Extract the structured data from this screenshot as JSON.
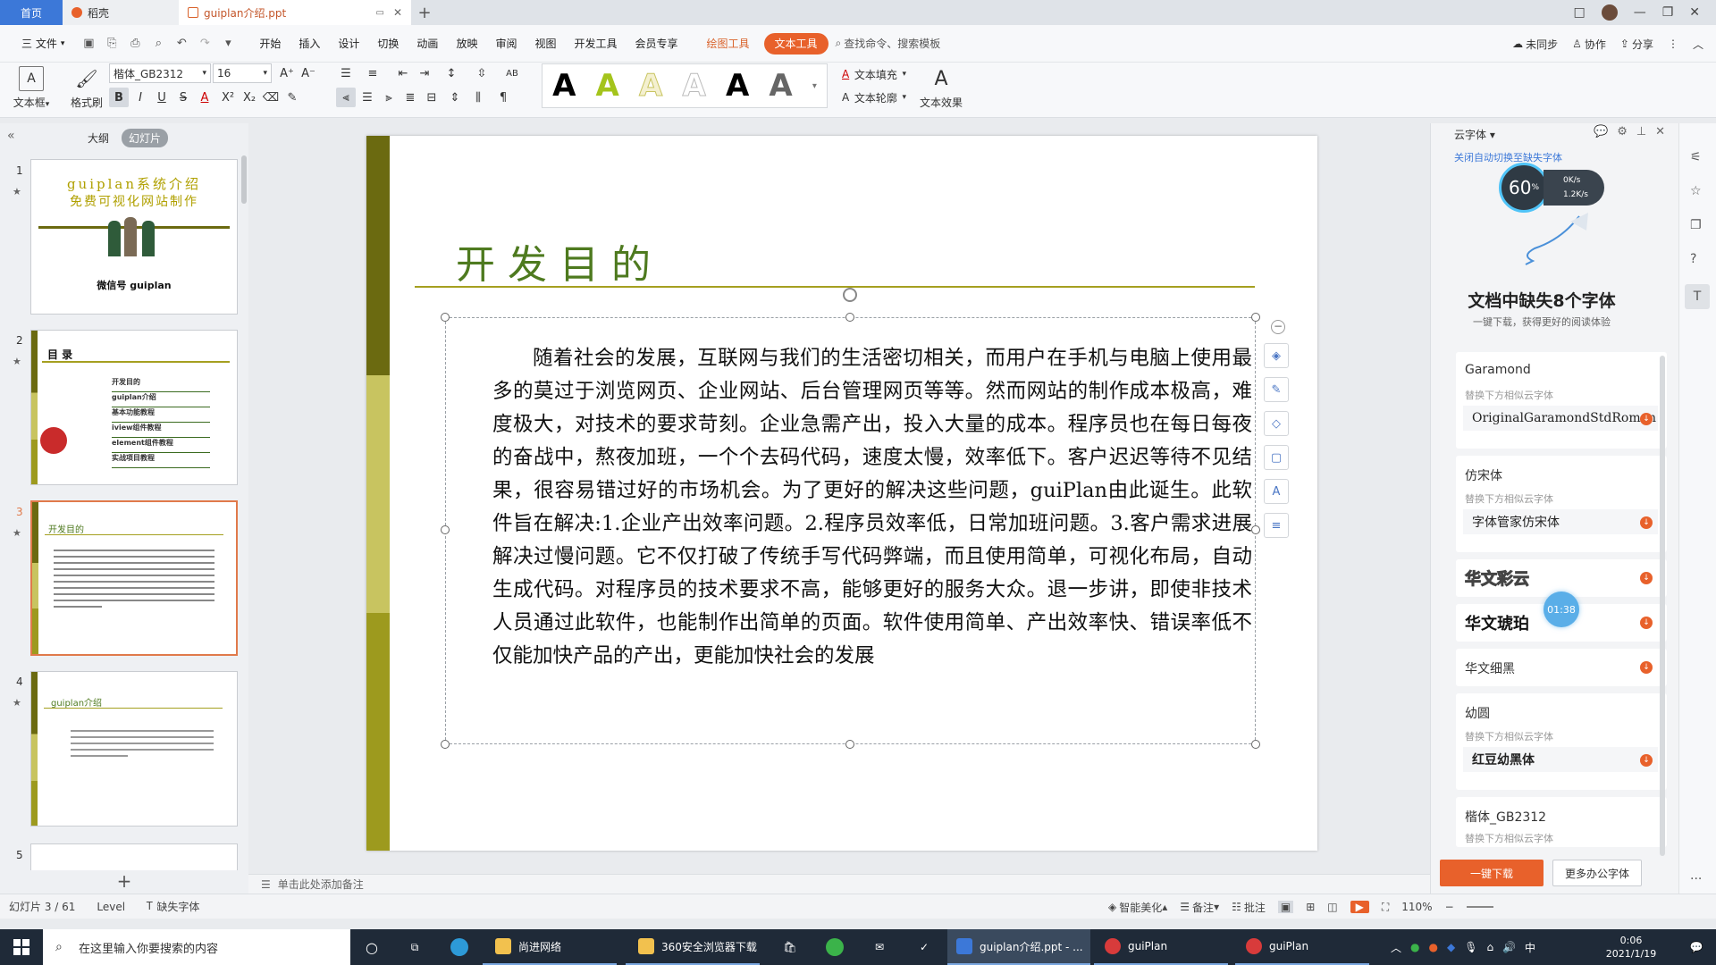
{
  "titlebar": {
    "tabs": [
      "首页",
      "稻壳",
      "guiplan介绍.ppt"
    ],
    "plus": "+",
    "win_controls": [
      "□",
      "—",
      "❐",
      "✕"
    ]
  },
  "menubar": {
    "file": "三 文件",
    "items": [
      "开始",
      "插入",
      "设计",
      "切换",
      "动画",
      "放映",
      "审阅",
      "视图",
      "开发工具",
      "会员专享"
    ],
    "drawing_tools": "绘图工具",
    "text_tools": "文本工具",
    "search": "查找命令、搜索模板",
    "right": [
      "未同步",
      "协作",
      "分享"
    ]
  },
  "ribbon": {
    "textbox_label": "文本框",
    "format_painter_label": "格式刷",
    "font_name": "楷体_GB2312",
    "font_size": "16",
    "gallery_glyph": "A",
    "text_fill": "文本填充",
    "text_outline": "文本轮廓",
    "text_effect": "文本效果"
  },
  "leftpanel": {
    "tab_outline": "大纲",
    "tab_slides": "幻灯片",
    "slide_nums": [
      "1",
      "2",
      "3",
      "4",
      "5"
    ],
    "thumb1_title": "guiplan系统介绍",
    "thumb1_sub": "免费可视化网站制作",
    "thumb1_wechat": "微信号   guiplan",
    "thumb2_title": "目 录",
    "thumb2_items": [
      "开发目的",
      "guiplan介绍",
      "基本功能教程",
      "iview组件教程",
      "element组件教程",
      "实战项目教程"
    ],
    "thumb3_title": "开发目的",
    "thumb4_title": "guiplan介绍",
    "add_slide": "+"
  },
  "slide": {
    "title": "开发目的",
    "body": "随着社会的发展，互联网与我们的生活密切相关，而用户在手机与电脑上使用最多的莫过于浏览网页、企业网站、后台管理网页等等。然而网站的制作成本极高，难度极大，对技术的要求苛刻。企业急需产出，投入大量的成本。程序员也在每日每夜的奋战中，熬夜加班，一个个去码代码，速度太慢，效率低下。客户迟迟等待不见结果，很容易错过好的市场机会。为了更好的解决这些问题，guiPlan由此诞生。此软件旨在解决:1.企业产出效率问题。2.程序员效率低，日常加班问题。3.客户需求进展解决过慢问题。它不仅打破了传统手写代码弊端，而且使用简单，可视化布局，自动生成代码。对程序员的技术要求不高，能够更好的服务大众。退一步讲，即使非技术人员通过此软件，也能制作出简单的页面。软件使用简单、产出效率快、错误率低不仅能加快产品的产出，更能加快社会的发展"
  },
  "notes": {
    "placeholder": "单击此处添加备注"
  },
  "rightpanel": {
    "header": "云字体",
    "notice": "关闭自动切换至缺失字体",
    "speed_percent": "60",
    "speed_unit": "%",
    "speed_up": "0K/s",
    "speed_down": "1.2K/s",
    "missing_title": "文档中缺失8个字体",
    "missing_sub": "一键下载，获得更好的阅读体验",
    "replace_hint": "替换下方相似云字体",
    "fonts": [
      {
        "name": "Garamond",
        "similar": "OriginalGaramondStdRoman"
      },
      {
        "name": "仿宋体",
        "similar": "字体管家仿宋体"
      },
      {
        "name": "华文彩云",
        "similar": ""
      },
      {
        "name": "华文琥珀",
        "similar": ""
      },
      {
        "name": "华文细黑",
        "similar": ""
      },
      {
        "name": "幼圆",
        "similar": "红豆幼黑体"
      },
      {
        "name": "楷体_GB2312",
        "similar": ""
      }
    ],
    "timer": "01:38",
    "download_all": "一键下载",
    "more_fonts": "更多办公字体"
  },
  "statusbar": {
    "slide_info": "幻灯片 3 / 61",
    "level": "Level",
    "missing_fonts": "缺失字体",
    "smart_beautify": "智能美化",
    "notes": "备注",
    "comments": "批注",
    "zoom": "110%"
  },
  "taskbar": {
    "search_placeholder": "在这里输入你要搜索的内容",
    "items": [
      "尚进网络",
      "360安全浏览器下载",
      "guiplan介绍.ppt - ...",
      "guiPlan",
      "guiPlan"
    ],
    "ime": "中",
    "time": "0:06",
    "date": "2021/1/19"
  },
  "colors": {
    "accent": "#e8612b",
    "title_green": "#4e7a1f",
    "olive_dark": "#6b6a10",
    "olive_light": "#c8c460",
    "olive_mid": "#9d9a1e"
  }
}
